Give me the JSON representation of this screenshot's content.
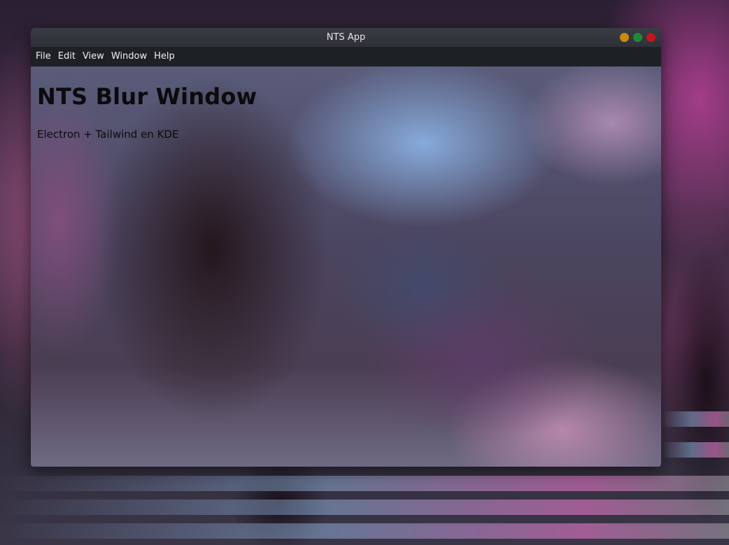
{
  "window": {
    "title": "NTS App",
    "buttons": [
      {
        "name": "minimize",
        "color": "#c98a10"
      },
      {
        "name": "maximize",
        "color": "#1f8a36"
      },
      {
        "name": "close",
        "color": "#c4141c"
      }
    ]
  },
  "menu": {
    "file": "File",
    "edit": "Edit",
    "view": "View",
    "window": "Window",
    "help": "Help"
  },
  "content": {
    "heading": "NTS Blur Window",
    "subtitle": "Electron + Tailwind en KDE"
  },
  "colors": {
    "menubar": "#1d2024",
    "titlebar": "#34363d",
    "text": "#0b0b0d"
  }
}
